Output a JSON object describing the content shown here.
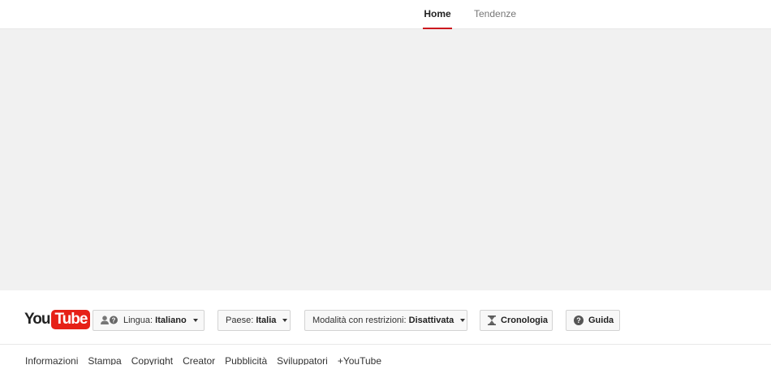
{
  "tabs": {
    "home": "Home",
    "trending": "Tendenze"
  },
  "logo": {
    "you": "You",
    "tube": "Tube"
  },
  "footer_buttons": {
    "language_label": "Lingua:",
    "language_value": "Italiano",
    "country_label": "Paese:",
    "country_value": "Italia",
    "restricted_label": "Modalità con restrizioni:",
    "restricted_value": "Disattivata",
    "history": "Cronologia",
    "help": "Guida"
  },
  "footer_links": [
    "Informazioni",
    "Stampa",
    "Copyright",
    "Creator",
    "Pubblicità",
    "Sviluppatori",
    "+YouTube"
  ],
  "colors": {
    "accent_red": "#cc181e",
    "logo_red": "#e62117",
    "content_bg": "#f1f1f1"
  },
  "icons": {
    "language": "language-people-icon",
    "history": "hourglass-icon",
    "help": "help-circle-icon"
  }
}
